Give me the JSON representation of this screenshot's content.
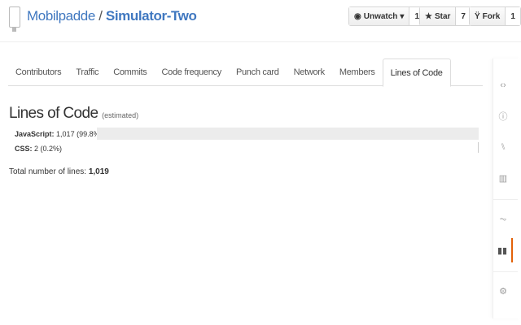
{
  "repo": {
    "owner": "Mobilpadde",
    "separator": "/",
    "name": "Simulator-Two"
  },
  "actions": {
    "watch": {
      "label": "Unwatch",
      "count": "1"
    },
    "star": {
      "label": "Star",
      "count": "7"
    },
    "fork": {
      "label": "Fork",
      "count": "1"
    }
  },
  "tabs": [
    "Contributors",
    "Traffic",
    "Commits",
    "Code frequency",
    "Punch card",
    "Network",
    "Members",
    "Lines of Code"
  ],
  "active_tab": "Lines of Code",
  "main": {
    "title": "Lines of Code",
    "subtitle": "(estimated)",
    "languages": [
      {
        "name": "JavaScript:",
        "value": "1,017 (99.8%)",
        "fraction": 0.998
      },
      {
        "name": "CSS:",
        "value": "2 (0.2%)",
        "fraction": 0.002
      }
    ],
    "total_label": "Total number of lines:",
    "total_value": "1,019"
  },
  "sidebar": [
    "code-icon",
    "issues-icon",
    "pull-requests-icon",
    "wiki-icon",
    "pulse-icon",
    "graphs-icon",
    "settings-icon"
  ],
  "accent": "#e36209"
}
